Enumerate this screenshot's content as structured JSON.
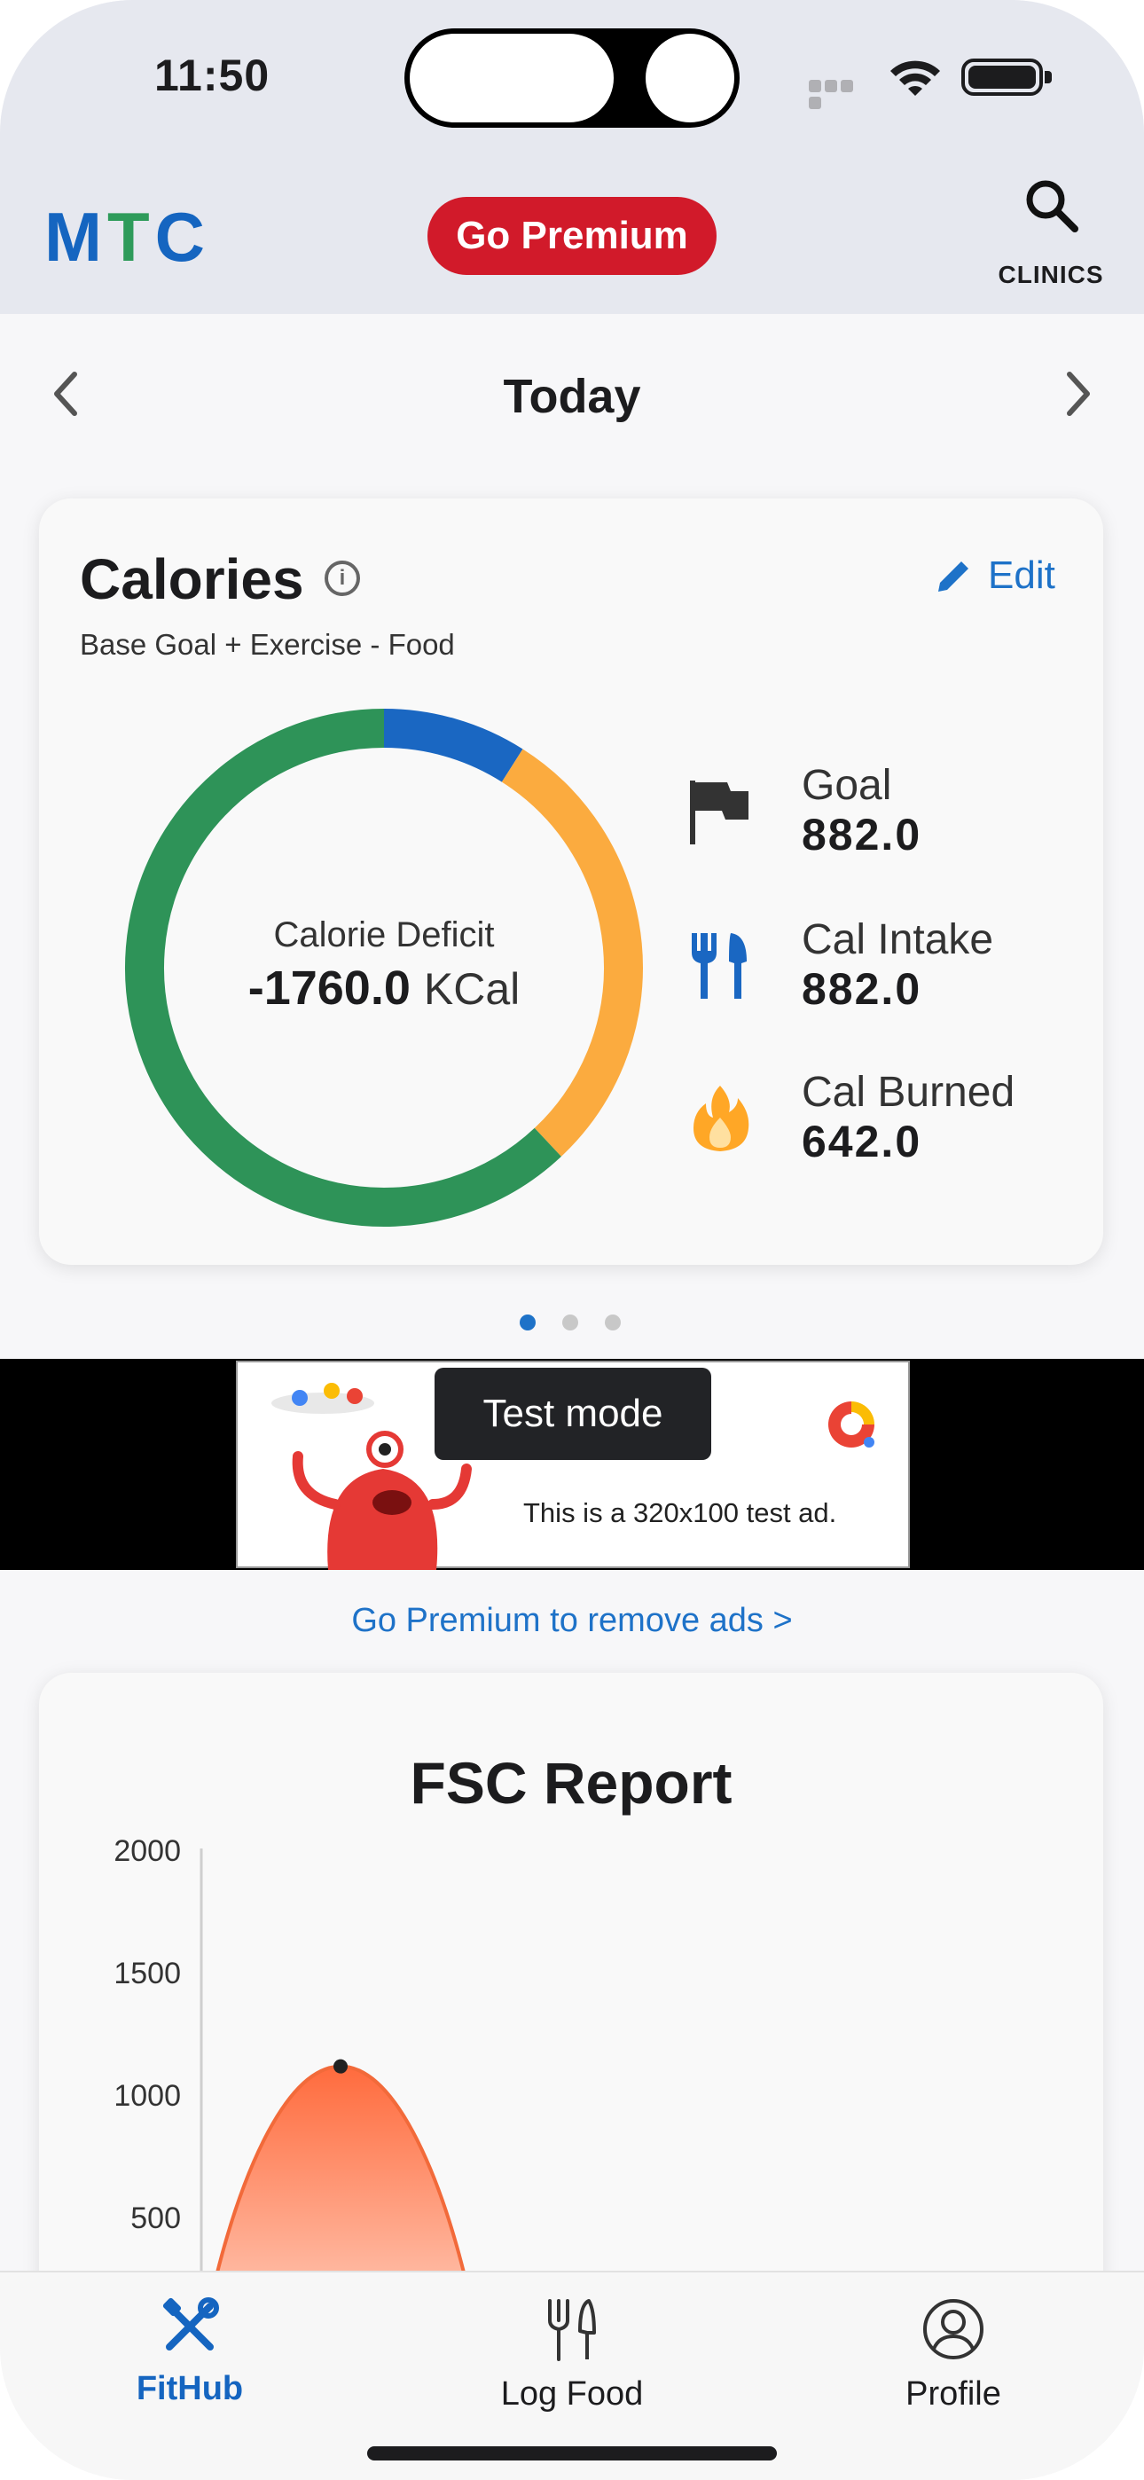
{
  "status_bar": {
    "time": "11:50"
  },
  "header": {
    "logo": {
      "m": "M",
      "t": "T",
      "c": "C"
    },
    "premium_label": "Go Premium",
    "clinics_label": "CLINICS"
  },
  "date_nav": {
    "title": "Today"
  },
  "calories": {
    "title": "Calories",
    "info_glyph": "i",
    "edit_label": "Edit",
    "subtitle": "Base Goal + Exercise - Food",
    "deficit_caption": "Calorie Deficit",
    "deficit_value": "-1760.0",
    "deficit_unit": "KCal",
    "ring_segments": [
      {
        "fraction": 0.09,
        "color": "#1a67c2"
      },
      {
        "fraction": 0.29,
        "color": "#fbab3f"
      },
      {
        "fraction": 0.62,
        "color": "#2e9358"
      }
    ],
    "stats": [
      {
        "label": "Goal",
        "value": "882.0",
        "icon": "flag-icon"
      },
      {
        "label": "Cal Intake",
        "value": "882.0",
        "icon": "fork-knife-icon"
      },
      {
        "label": "Cal Burned",
        "value": "642.0",
        "icon": "flame-icon"
      }
    ]
  },
  "pager": {
    "active_index": 0,
    "count": 3,
    "active_color": "#1e72c8",
    "inactive_color": "#c8c8c8"
  },
  "ad": {
    "tooltip": "Test mode",
    "text": "This is a 320x100 test ad."
  },
  "remove_ads_link": "Go Premium to remove ads >",
  "fsc_report": {
    "title": "FSC Report"
  },
  "chart_data": {
    "type": "area",
    "title": "FSC Report",
    "ylim": [
      0,
      2000
    ],
    "yticks": [
      "2000",
      "1500",
      "1000",
      "500"
    ],
    "peak_value": 1290,
    "fill_color": "#ff7b4f"
  },
  "tabbar": {
    "tabs": [
      {
        "label": "FitHub",
        "icon": "fithub-tools-icon",
        "active": true
      },
      {
        "label": "Log Food",
        "icon": "utensils-icon",
        "active": false
      },
      {
        "label": "Profile",
        "icon": "profile-icon",
        "active": false
      }
    ],
    "active_color": "#1565c0"
  }
}
